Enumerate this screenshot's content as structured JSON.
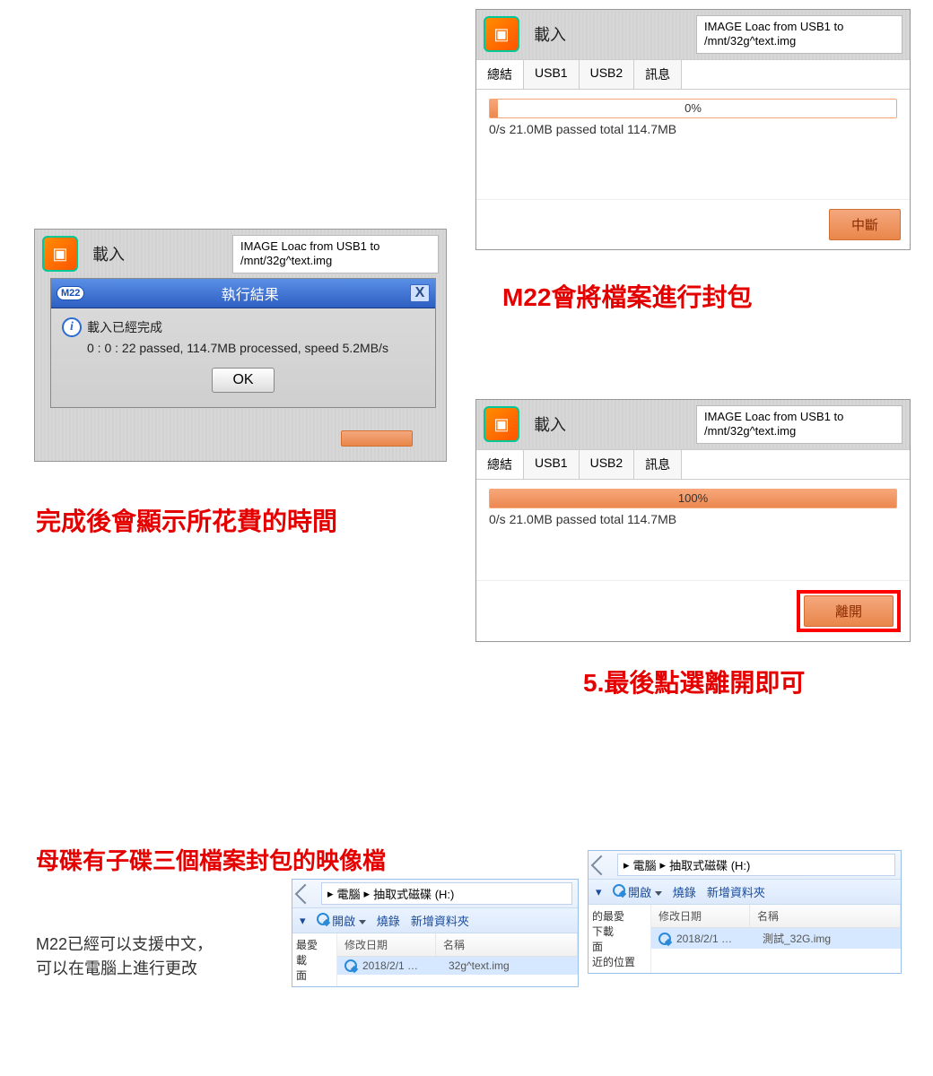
{
  "dlg1": {
    "load": "載入",
    "title1": "IMAGE Loac from USB1 to",
    "title2": "/mnt/32g^text.img",
    "tabs": [
      "總結",
      "USB1",
      "USB2",
      "訊息"
    ],
    "pct": "0%",
    "stat": "0/s  21.0MB  passed  total  114.7MB",
    "btn": "中斷"
  },
  "dlg2": {
    "load": "載入",
    "title1": "IMAGE Loac from USB1 to",
    "title2": "/mnt/32g^text.img",
    "tabs": [
      "總結",
      "USB1",
      "USB2",
      "訊息"
    ],
    "pct": "100%",
    "stat": "0/s  21.0MB  passed  total  114.7MB",
    "btn": "離開"
  },
  "result": {
    "badge": "M22",
    "title": "執行結果",
    "line1": "載入已經完成",
    "line2": "0 : 0 : 22 passed, 114.7MB processed, speed 5.2MB/s",
    "ok": "OK",
    "bg_load": "載入",
    "bg_title1": "IMAGE Loac from USB1 to",
    "bg_title2": "/mnt/32g^text.img"
  },
  "cap1": "M22會將檔案進行封包",
  "cap2": "完成後會顯示所花費的時間",
  "cap3": "5.最後點選離開即可",
  "cap4": "母碟有子碟三個檔案封包的映像檔",
  "note1": "M22已經可以支援中文，",
  "note2": "可以在電腦上進行更改",
  "exp1": {
    "crumb1": "電腦",
    "crumb2": "抽取式磁碟 (H:)",
    "open": "開啟",
    "burn": "燒錄",
    "newf": "新增資料夾",
    "hdate": "修改日期",
    "hname": "名稱",
    "side": [
      "最愛",
      "載",
      "面"
    ],
    "date": "2018/2/1 …",
    "file": "32g^text.img"
  },
  "exp2": {
    "crumb1": "電腦",
    "crumb2": "抽取式磁碟 (H:)",
    "open": "開啟",
    "burn": "燒錄",
    "newf": "新增資料夾",
    "hdate": "修改日期",
    "hname": "名稱",
    "side": [
      "的最愛",
      "下載",
      "面",
      "近的位置"
    ],
    "date": "2018/2/1 …",
    "file": "測試_32G.img"
  }
}
